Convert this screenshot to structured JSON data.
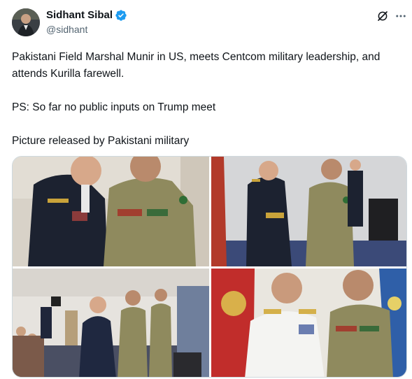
{
  "author": {
    "name": "Sidhant Sibal",
    "handle": "@sidhant",
    "verified_icon": "verified-badge-icon",
    "avatar_icon": "avatar"
  },
  "actions": {
    "grok_icon": "grok-icon",
    "more_icon": "more-options-icon"
  },
  "tweet": {
    "line1": "Pakistani Field Marshal Munir in US, meets Centcom military leadership, and attends Kurilla farewell.",
    "line2": "PS: So far no public inputs on Trump meet",
    "line3": "Picture released by Pakistani military"
  },
  "colors": {
    "accent": "#1d9bf0",
    "text": "#0f1419",
    "secondary": "#536471"
  }
}
